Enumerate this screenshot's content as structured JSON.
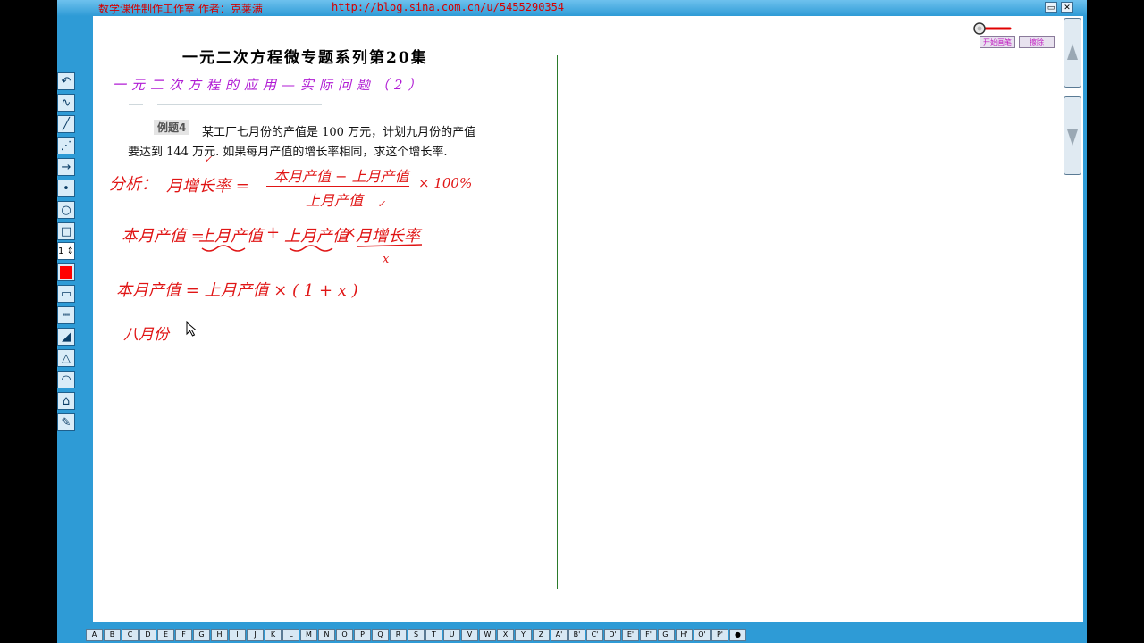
{
  "window": {
    "title": "数学课件制作工作室 作者：克莱满",
    "url": "http://blog.sina.com.cn/u/5455290354",
    "buttons": [
      "▭",
      "✕"
    ]
  },
  "colors": {
    "chrome": "#2e9bd6",
    "title_text": "#d40000",
    "handwriting": "#e01515",
    "subtitle": "#b01bd4",
    "divider": "#2b7a2b"
  },
  "toolbar": {
    "tools": [
      {
        "name": "undo-icon",
        "glyph": "↶"
      },
      {
        "name": "freehand-curve-icon",
        "glyph": "∿"
      },
      {
        "name": "straight-line-icon",
        "glyph": "╱"
      },
      {
        "name": "dotted-line-icon",
        "glyph": "⋰"
      },
      {
        "name": "arrow-icon",
        "glyph": "→"
      },
      {
        "name": "point-icon",
        "glyph": "•"
      },
      {
        "name": "circle-icon",
        "glyph": "○"
      },
      {
        "name": "rectangle-icon",
        "glyph": "□"
      }
    ],
    "line_width": "1",
    "pen_color": "#ff0000",
    "tools2": [
      {
        "name": "ruler-icon",
        "glyph": "▭"
      },
      {
        "name": "measure-ruler-icon",
        "glyph": "┉"
      },
      {
        "name": "triangle-ruler-icon",
        "glyph": "◢"
      },
      {
        "name": "triangle-ruler-2-icon",
        "glyph": "△"
      },
      {
        "name": "protractor-icon",
        "glyph": "◠"
      },
      {
        "name": "compass-icon",
        "glyph": "⌂"
      },
      {
        "name": "pen-eraser-icon",
        "glyph": "✎"
      }
    ]
  },
  "document": {
    "title": "一元二次方程微专题系列第20集",
    "subtitle": "一元二次方程的应用—实际问题（2）",
    "example_label": "例题4",
    "example_line1": "某工厂七月份的产值是 100 万元，计划九月份的产值",
    "example_line2": "要达到 144 万元. 如果每月产值的增长率相同，求这个增长率."
  },
  "handwriting": {
    "analysis": "分析：",
    "growth_rate": "月增长率 =",
    "num": "本月产值 − 上月产值",
    "den": "上月产值",
    "times100": "× 100%",
    "eq2_lhs": "本月产值 =",
    "eq2_a": "上月产值",
    "eq2_plus": "+",
    "eq2_b": "上月产值",
    "eq2_times": "×",
    "eq2_c": "月增长率",
    "eq2_x": "x",
    "eq3": "本月产值 = 上月产值 × ( 1 + x )",
    "line4": "八月份",
    "check": "✓"
  },
  "top_buttons": {
    "start": "开始画笔",
    "clear": "擦除"
  },
  "alphabet": [
    "A",
    "B",
    "C",
    "D",
    "E",
    "F",
    "G",
    "H",
    "I",
    "J",
    "K",
    "L",
    "M",
    "N",
    "O",
    "P",
    "Q",
    "R",
    "S",
    "T",
    "U",
    "V",
    "W",
    "X",
    "Y",
    "Z",
    "A'",
    "B'",
    "C'",
    "D'",
    "E'",
    "F'",
    "G'",
    "H'",
    "O'",
    "P'",
    "●"
  ]
}
